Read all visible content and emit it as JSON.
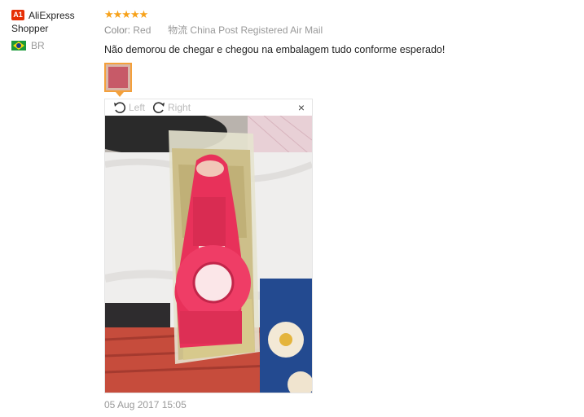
{
  "user": {
    "badge": "A1",
    "name_line1": "AliExpress",
    "name_line2": "Shopper",
    "country": "BR"
  },
  "review": {
    "stars": "★★★★★",
    "rating": 5,
    "color_label": "Color:",
    "color_value": "Red",
    "shipping_prefix": "物流",
    "shipping_value": "China Post Registered Air Mail",
    "comment": "Não demorou de chegar e chegou na embalagem tudo conforme esperado!",
    "date": "05 Aug 2017 15:05"
  },
  "viewer": {
    "left_label": "Left",
    "right_label": "Right",
    "close_label": "×"
  },
  "colors": {
    "star": "#f7a21b",
    "accent": "#f3a03b",
    "badge": "#e62e04",
    "product": "#e8315a"
  }
}
